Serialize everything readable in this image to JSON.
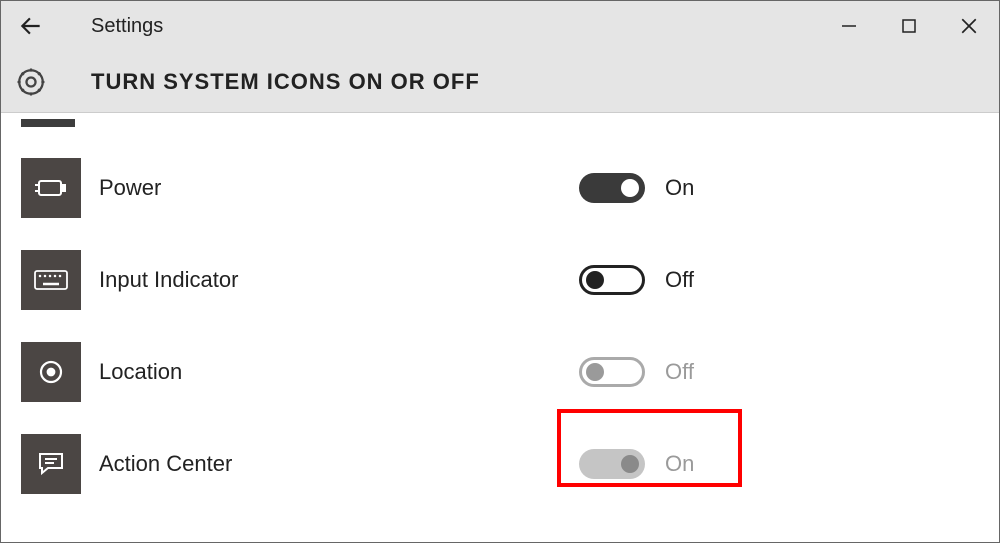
{
  "app_title": "Settings",
  "page_title": "TURN SYSTEM ICONS ON OR OFF",
  "rows": {
    "r0": {
      "label": "Power",
      "state": "On"
    },
    "r1": {
      "label": "Input Indicator",
      "state": "Off"
    },
    "r2": {
      "label": "Location",
      "state": "Off"
    },
    "r3": {
      "label": "Action Center",
      "state": "On"
    }
  }
}
